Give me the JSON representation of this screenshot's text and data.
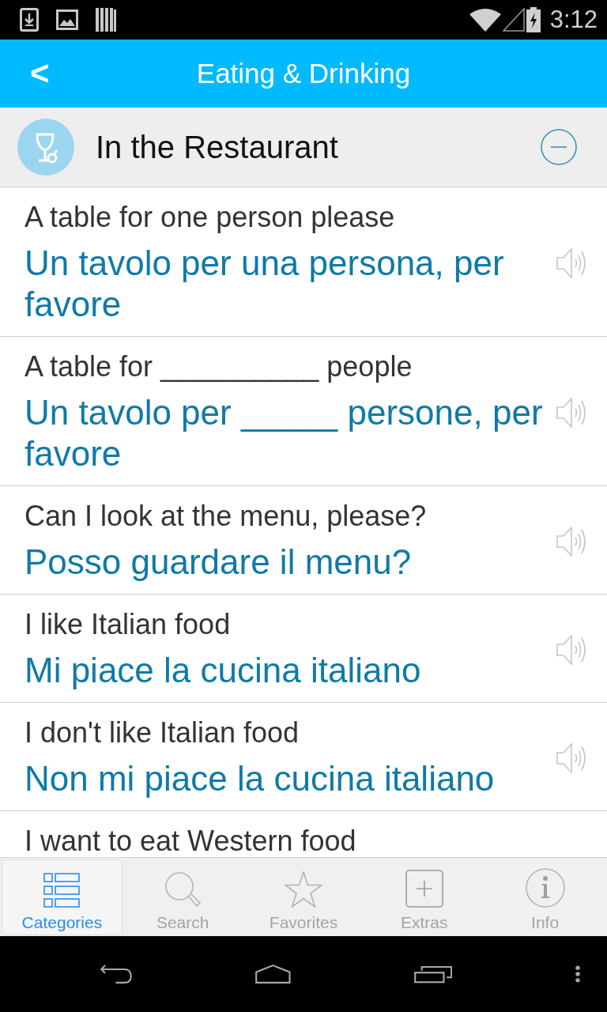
{
  "status_bar": {
    "time": "3:12"
  },
  "app_bar": {
    "back": "<",
    "title": "Eating & Drinking"
  },
  "category": {
    "title": "In the Restaurant",
    "expanded": true
  },
  "phrases": [
    {
      "english": "A table for one person please",
      "italian": "Un tavolo per una persona, per favore"
    },
    {
      "english": "A table for __________ people",
      "italian": "Un tavolo per _____ persone, per favore"
    },
    {
      "english": "Can I look at the menu, please?",
      "italian": "Posso guardare il menu?"
    },
    {
      "english": "I like Italian food",
      "italian": "Mi piace la cucina italiano"
    },
    {
      "english": "I don't like Italian food",
      "italian": "Non mi piace la cucina italiano"
    },
    {
      "english": "I want to eat Western food"
    }
  ],
  "tabs": [
    {
      "label": "Categories",
      "selected": true
    },
    {
      "label": "Search",
      "selected": false
    },
    {
      "label": "Favorites",
      "selected": false
    },
    {
      "label": "Extras",
      "selected": false
    },
    {
      "label": "Info",
      "selected": false
    }
  ]
}
